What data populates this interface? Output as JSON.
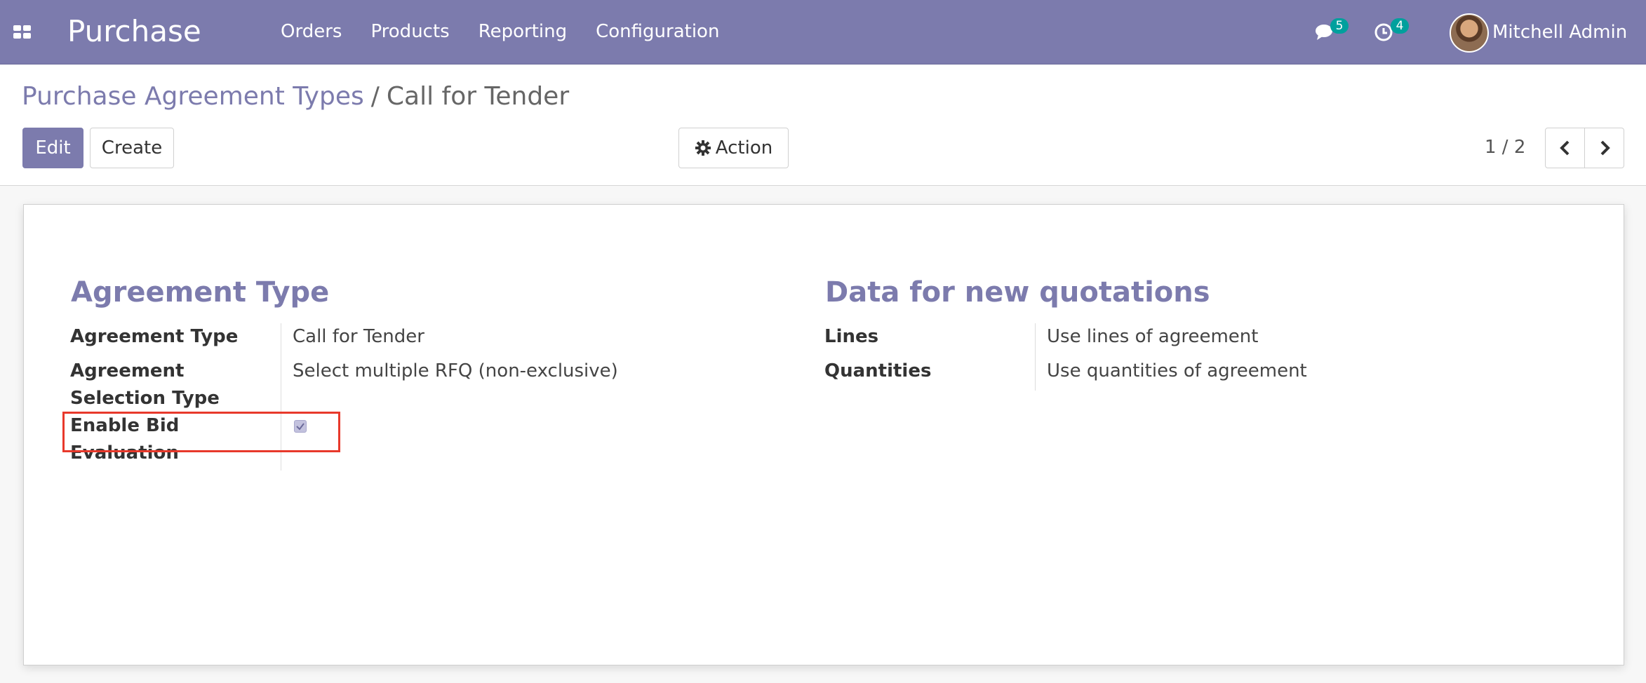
{
  "navbar": {
    "app_name": "Purchase",
    "menu": [
      "Orders",
      "Products",
      "Reporting",
      "Configuration"
    ],
    "messages_count": "5",
    "activities_count": "4",
    "user_name": "Mitchell Admin"
  },
  "breadcrumb": {
    "parent": "Purchase Agreement Types",
    "separator": "/",
    "current": "Call for Tender"
  },
  "buttons": {
    "edit": "Edit",
    "create": "Create",
    "action": "Action"
  },
  "pager": {
    "value": "1 / 2"
  },
  "form": {
    "left_title": "Agreement Type",
    "right_title": "Data for new quotations",
    "agreement_type_label": "Agreement Type",
    "agreement_type_value": "Call for Tender",
    "selection_label_1": "Agreement",
    "selection_label_2": "Selection Type",
    "selection_value": "Select multiple RFQ (non-exclusive)",
    "bid_label_1": "Enable Bid",
    "bid_label_2": "Evaluation",
    "bid_checked": true,
    "lines_label": "Lines",
    "lines_value": "Use lines of agreement",
    "quantities_label": "Quantities",
    "quantities_value": "Use quantities of agreement"
  },
  "icons": {
    "apps": "apps-grid-icon",
    "messages": "chat-icon",
    "activities": "clock-icon",
    "action": "gear-icon",
    "prev": "chevron-left-icon",
    "next": "chevron-right-icon"
  },
  "colors": {
    "brand": "#7c7bad",
    "badge": "#00a09d",
    "highlight": "#e8392b"
  }
}
